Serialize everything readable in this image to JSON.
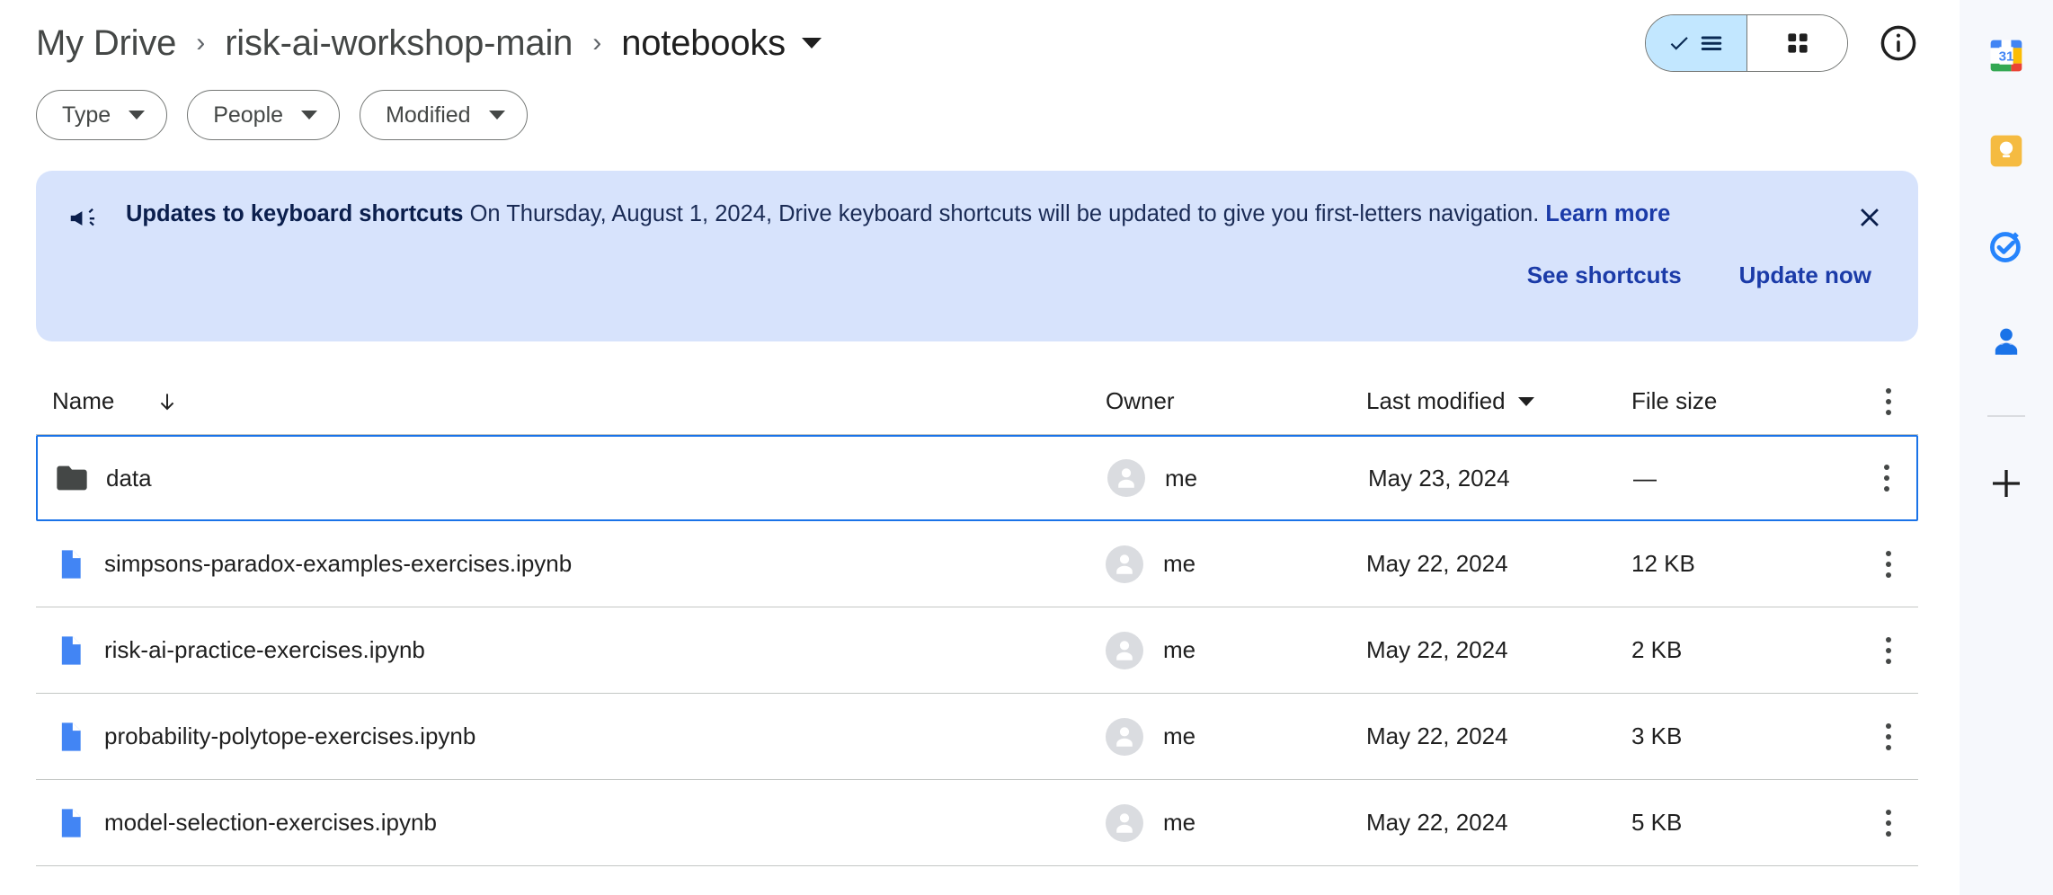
{
  "header": {
    "breadcrumb": [
      {
        "label": "My Drive",
        "current": false
      },
      {
        "label": "risk-ai-workshop-main",
        "current": false
      },
      {
        "label": "notebooks",
        "current": true
      }
    ],
    "separator": "›",
    "view_toggle": {
      "list_label": "list-view",
      "grid_label": "grid-view",
      "selected": "list"
    },
    "info_label": "details"
  },
  "filters": [
    {
      "label": "Type"
    },
    {
      "label": "People"
    },
    {
      "label": "Modified"
    }
  ],
  "banner": {
    "icon": "campaign-icon",
    "title": "Updates to keyboard shortcuts",
    "body": " On Thursday, August 1, 2024, Drive keyboard shortcuts will be updated to give you first-letters navigation. ",
    "link": "Learn more",
    "actions": [
      {
        "label": "See shortcuts"
      },
      {
        "label": "Update now"
      }
    ],
    "close_label": "✕",
    "background": "#d7e3fc",
    "accent": "#1b3ba8"
  },
  "table": {
    "columns": {
      "name": "Name",
      "owner": "Owner",
      "modified": "Last modified",
      "size": "File size"
    },
    "sort": {
      "column": "Name",
      "direction": "descending"
    },
    "rows": [
      {
        "icon": "folder-icon",
        "name": "data",
        "owner": "me",
        "modified": "May 23, 2024",
        "size": "—",
        "selected": true
      },
      {
        "icon": "file-icon",
        "name": "simpsons-paradox-examples-exercises.ipynb",
        "owner": "me",
        "modified": "May 22, 2024",
        "size": "12 KB",
        "selected": false
      },
      {
        "icon": "file-icon",
        "name": "risk-ai-practice-exercises.ipynb",
        "owner": "me",
        "modified": "May 22, 2024",
        "size": "2 KB",
        "selected": false
      },
      {
        "icon": "file-icon",
        "name": "probability-polytope-exercises.ipynb",
        "owner": "me",
        "modified": "May 22, 2024",
        "size": "3 KB",
        "selected": false
      },
      {
        "icon": "file-icon",
        "name": "model-selection-exercises.ipynb",
        "owner": "me",
        "modified": "May 22, 2024",
        "size": "5 KB",
        "selected": false
      }
    ]
  },
  "sidepanel": {
    "items": [
      {
        "name": "google-calendar-icon",
        "badge": "31"
      },
      {
        "name": "google-keep-icon"
      },
      {
        "name": "google-tasks-icon"
      },
      {
        "name": "google-contacts-icon"
      }
    ],
    "add_label": "+"
  }
}
